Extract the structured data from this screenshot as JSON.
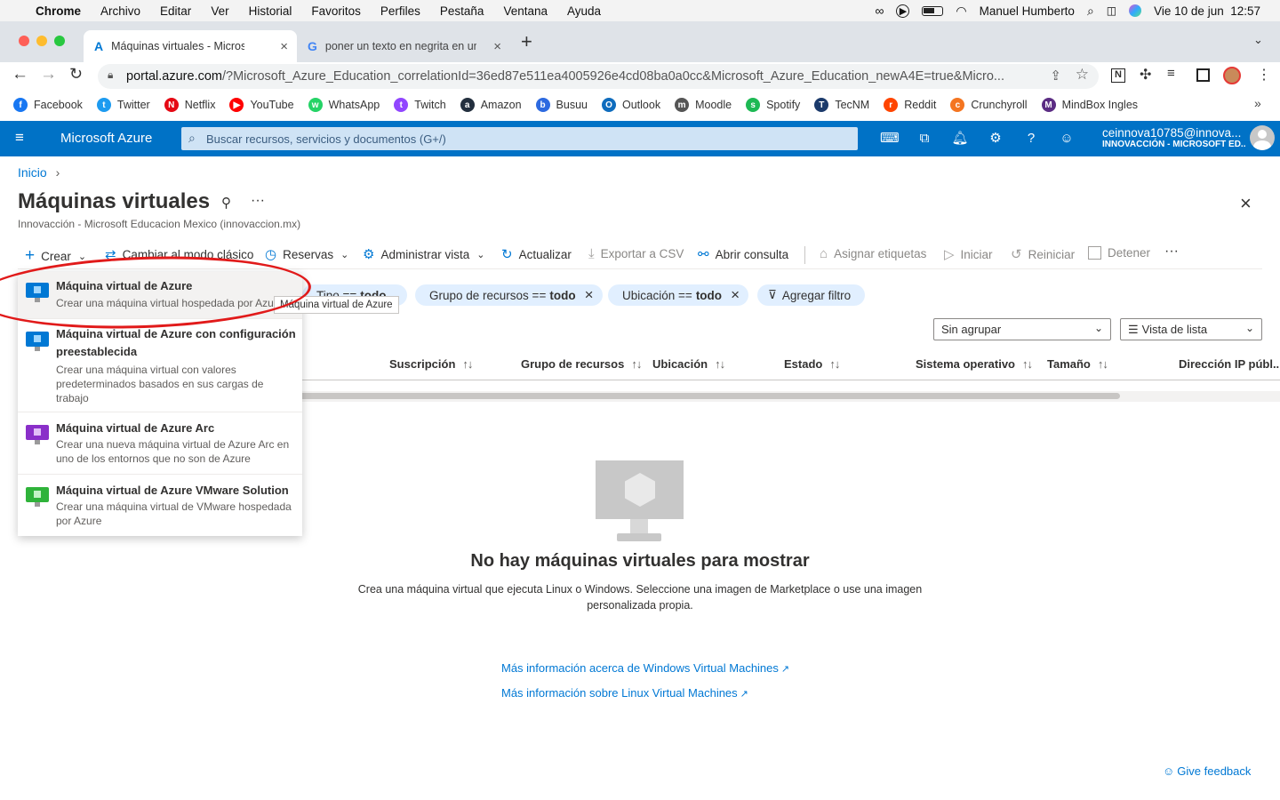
{
  "menubar": {
    "items": [
      "Chrome",
      "Archivo",
      "Editar",
      "Ver",
      "Historial",
      "Favoritos",
      "Perfiles",
      "Pestaña",
      "Ventana",
      "Ayuda"
    ],
    "user": "Manuel Humberto",
    "datetime": "Vie 10 de jun  12:57"
  },
  "tabs": [
    {
      "title": "Máquinas virtuales - Microsoft"
    },
    {
      "title": "poner un texto en negrita en un"
    }
  ],
  "address": {
    "host": "portal.azure.com",
    "path": "/?Microsoft_Azure_Education_correlationId=36ed87e511ea4005926e4cd08ba0a0cc&Microsoft_Azure_Education_newA4E=true&Micro..."
  },
  "bookmarks": [
    {
      "label": "Facebook",
      "color": "#1877f2",
      "glyph": "f"
    },
    {
      "label": "Twitter",
      "color": "#1d9bf0",
      "glyph": "t"
    },
    {
      "label": "Netflix",
      "color": "#e50914",
      "glyph": "N"
    },
    {
      "label": "YouTube",
      "color": "#ff0000",
      "glyph": "▶"
    },
    {
      "label": "WhatsApp",
      "color": "#25d366",
      "glyph": "w"
    },
    {
      "label": "Twitch",
      "color": "#9146ff",
      "glyph": "t"
    },
    {
      "label": "Amazon",
      "color": "#232f3e",
      "glyph": "a"
    },
    {
      "label": "Busuu",
      "color": "#2d6ae0",
      "glyph": "b"
    },
    {
      "label": "Outlook",
      "color": "#0f6cbd",
      "glyph": "O"
    },
    {
      "label": "Moodle",
      "color": "#555555",
      "glyph": "m"
    },
    {
      "label": "Spotify",
      "color": "#1db954",
      "glyph": "s"
    },
    {
      "label": "TecNM",
      "color": "#1b3a6b",
      "glyph": "T"
    },
    {
      "label": "Reddit",
      "color": "#ff4500",
      "glyph": "r"
    },
    {
      "label": "Crunchyroll",
      "color": "#f47521",
      "glyph": "c"
    },
    {
      "label": "MindBox Ingles",
      "color": "#5b2c83",
      "glyph": "M"
    }
  ],
  "azure": {
    "brand": "Microsoft Azure",
    "search_placeholder": "Buscar recursos, servicios y documentos (G+/)",
    "account_email": "ceinnova10785@innova...",
    "account_tenant": "INNOVACCIÓN - MICROSOFT ED..."
  },
  "page": {
    "breadcrumb": "Inicio",
    "title": "Máquinas virtuales",
    "subtitle": "Innovacción - Microsoft Educacion Mexico (innovaccion.mx)"
  },
  "commands": {
    "create": "Crear",
    "classic": "Cambiar al modo clásico",
    "reservations": "Reservas",
    "manage_view": "Administrar vista",
    "refresh": "Actualizar",
    "export_csv": "Exportar a CSV",
    "open_query": "Abrir consulta",
    "assign_tags": "Asignar etiquetas",
    "start": "Iniciar",
    "restart": "Reiniciar",
    "stop": "Detener"
  },
  "filters": {
    "type": {
      "label": "Tipo ==",
      "value": "todo"
    },
    "resource_group": {
      "label": "Grupo de recursos ==",
      "value": "todo"
    },
    "location": {
      "label": "Ubicación ==",
      "value": "todo"
    },
    "add_filter": "Agregar filtro"
  },
  "grouping": {
    "selected": "Sin agrupar"
  },
  "view_mode": {
    "selected": "Vista de lista"
  },
  "columns": [
    "Suscripción",
    "Grupo de recursos",
    "Ubicación",
    "Estado",
    "Sistema operativo",
    "Tamaño",
    "Dirección IP públ..."
  ],
  "create_menu": [
    {
      "title": "Máquina virtual de Azure",
      "desc": "Crear una máquina virtual hospedada por Azure"
    },
    {
      "title": "Máquina virtual de Azure con configuración preestablecida",
      "desc": "Crear una máquina virtual con valores predeterminados basados en sus cargas de trabajo"
    },
    {
      "title": "Máquina virtual de Azure Arc",
      "desc": "Crear una nueva máquina virtual de Azure Arc en uno de los entornos que no son de Azure"
    },
    {
      "title": "Máquina virtual de Azure VMware Solution",
      "desc": "Crear una máquina virtual de VMware hospedada por Azure"
    }
  ],
  "tooltip": "Máquina virtual de Azure",
  "empty_state": {
    "title": "No hay máquinas virtuales para mostrar",
    "desc": "Crea una máquina virtual que ejecuta Linux o Windows. Seleccione una imagen de Marketplace o use una imagen personalizada propia.",
    "link_windows": "Más información acerca de Windows Virtual Machines",
    "link_linux": "Más información sobre Linux Virtual Machines"
  },
  "feedback": "Give feedback",
  "colors": {
    "azure_blue": "#0072c6",
    "link": "#0078d4",
    "filter_pill": "#e1efff",
    "annotation": "#e11a1a"
  }
}
